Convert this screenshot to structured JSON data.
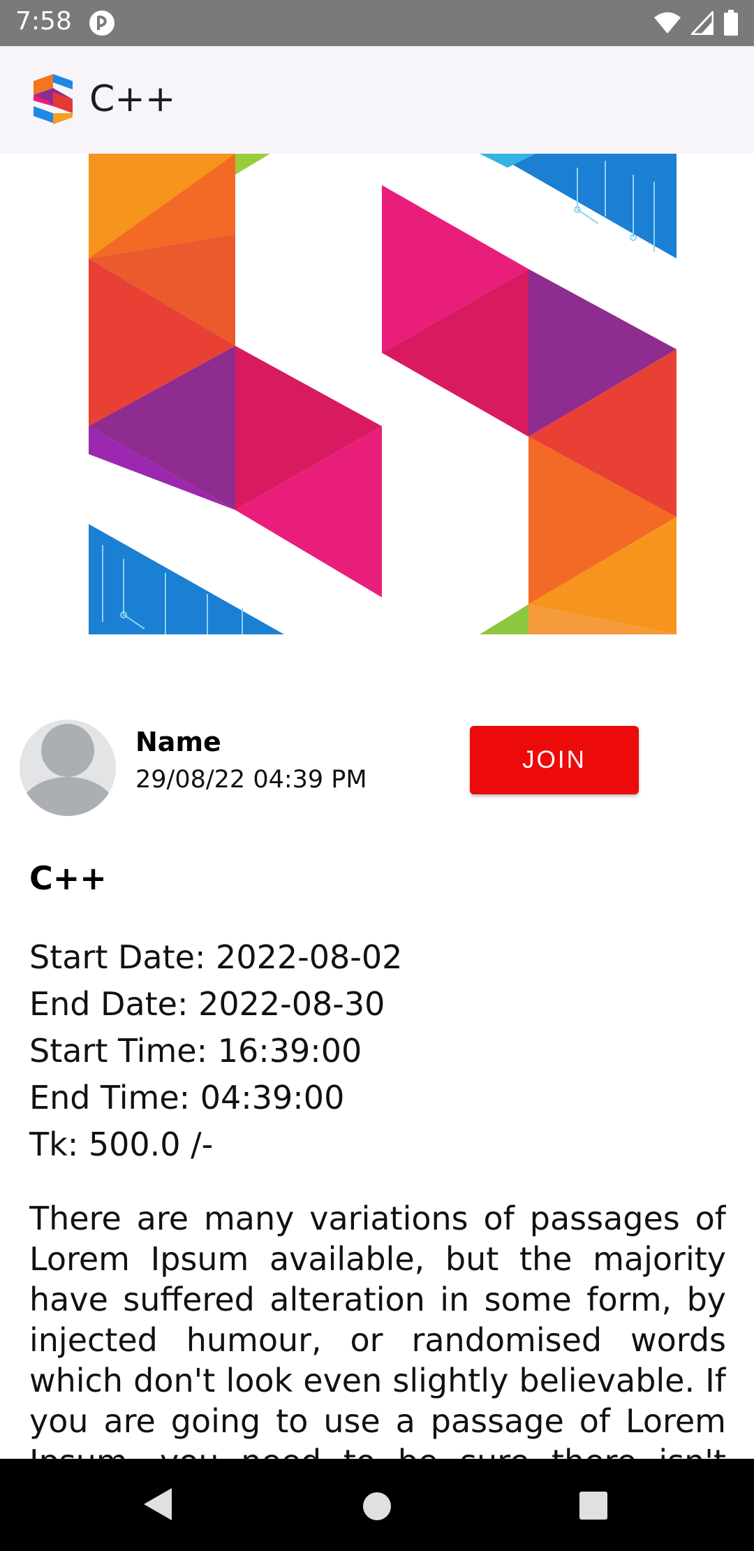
{
  "status_bar": {
    "time": "7:58",
    "icons": [
      "notification-app-icon",
      "wifi-icon",
      "signal-icon",
      "battery-icon"
    ]
  },
  "app_bar": {
    "title": "C++",
    "logo_icon": "app-logo-icon"
  },
  "banner": {
    "image": "course-banner-logo"
  },
  "author": {
    "name": "Name",
    "datetime": "29/08/22 04:39 PM",
    "avatar_icon": "person-avatar-icon"
  },
  "join_button": {
    "label": "JOIN",
    "color": "#ec0a0a"
  },
  "course": {
    "title": "C++",
    "start_date": "Start Date: 2022-08-02",
    "end_date": "End Date: 2022-08-30",
    "start_time": "Start Time: 16:39:00",
    "end_time": "End Time: 04:39:00",
    "price": "Tk: 500.0 /-",
    "description": "There are many variations of passages of Lorem Ipsum available, but the majority have suffered alteration in some form, by injected humour, or randomised words which don't look even slightly believable. If you are going to use a passage of Lorem Ipsum, you need to be sure there isn't anything embarrassing"
  },
  "nav_bar": {
    "icons": [
      "back-icon",
      "home-icon",
      "recent-apps-icon"
    ]
  }
}
